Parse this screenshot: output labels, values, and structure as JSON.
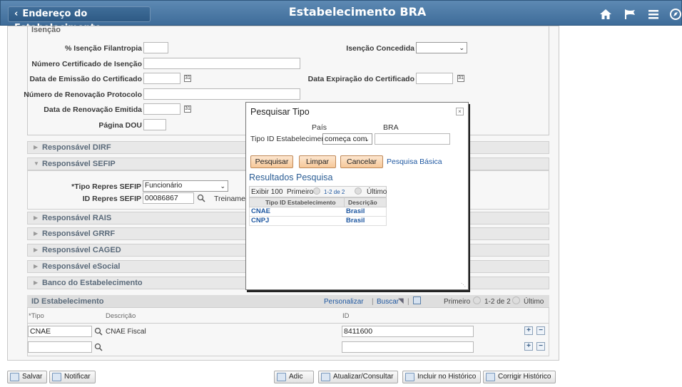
{
  "header": {
    "back_label": "Endereço do Estabelecimento",
    "title": "Estabelecimento BRA",
    "icons": [
      "home-icon",
      "flag-icon",
      "menu-icon",
      "navbar-icon"
    ]
  },
  "isencao": {
    "title": "Isenção",
    "pct_label": "% Isenção Filantropia",
    "pct_value": "",
    "concedida_label": "Isenção Concedida",
    "concedida_value": "",
    "cert_num_label": "Número Certificado de Isenção",
    "emissao_label": "Data de Emissão do Certificado",
    "expiracao_label": "Data Expiração do Certificado",
    "renov_prot_label": "Número de Renovação Protocolo",
    "renov_emit_label": "Data de Renovação Emitida",
    "pagina_label": "Página DOU",
    "cal_glyph": "31"
  },
  "sections": {
    "dirf": "Responsável DIRF",
    "sefip": "Responsável SEFIP",
    "rais": "Responsável RAIS",
    "grrf": "Responsável GRRF",
    "caged": "Responsável CAGED",
    "esocial": "Responsável eSocial",
    "banco": "Banco do Estabelecimento"
  },
  "sefip": {
    "tipo_label": "*Tipo Repres SEFIP",
    "tipo_value": "Funcionário",
    "id_label": "ID Repres SEFIP",
    "id_value": "00086867",
    "treinamento": "Treinamen"
  },
  "grid": {
    "title": "ID Estabelecimento",
    "personalizar": "Personalizar",
    "buscar": "Buscar",
    "separator": "|",
    "primeiro": "Primeiro",
    "range": "1-2 de 2",
    "ultimo": "Último",
    "columns": [
      "*Tipo",
      "Descrição",
      "ID"
    ],
    "rows": [
      {
        "tipo": "CNAE",
        "descricao": "CNAE Fiscal",
        "id": "8411600"
      },
      {
        "tipo": "",
        "descricao": "",
        "id": ""
      }
    ],
    "plus": "+",
    "minus": "−"
  },
  "footer": {
    "salvar": "Salvar",
    "notificar": "Notificar",
    "adic": "Adic",
    "atualizar": "Atualizar/Consultar",
    "incluir": "Incluir no Histórico",
    "corrigir": "Corrigir Histórico"
  },
  "modal": {
    "title": "Pesquisar Tipo",
    "close": "×",
    "pais_label": "País",
    "pais_value": "BRA",
    "tipo_label": "Tipo ID Estabelecimento",
    "operator": "começa com",
    "search_value": "",
    "btn_pesquisar": "Pesquisar",
    "btn_limpar": "Limpar",
    "btn_cancelar": "Cancelar",
    "pesquisa_basica": "Pesquisa Básica",
    "results_title": "Resultados Pesquisa",
    "exibir": "Exibir 100",
    "primeiro": "Primeiro",
    "range": "1-2 de 2",
    "ultimo": "Último",
    "columns": [
      "Tipo ID Estabelecimento",
      "Descrição"
    ],
    "rows": [
      {
        "tipo": "CNAE",
        "descricao": "Brasil"
      },
      {
        "tipo": "CNPJ",
        "descricao": "Brasil"
      }
    ]
  }
}
